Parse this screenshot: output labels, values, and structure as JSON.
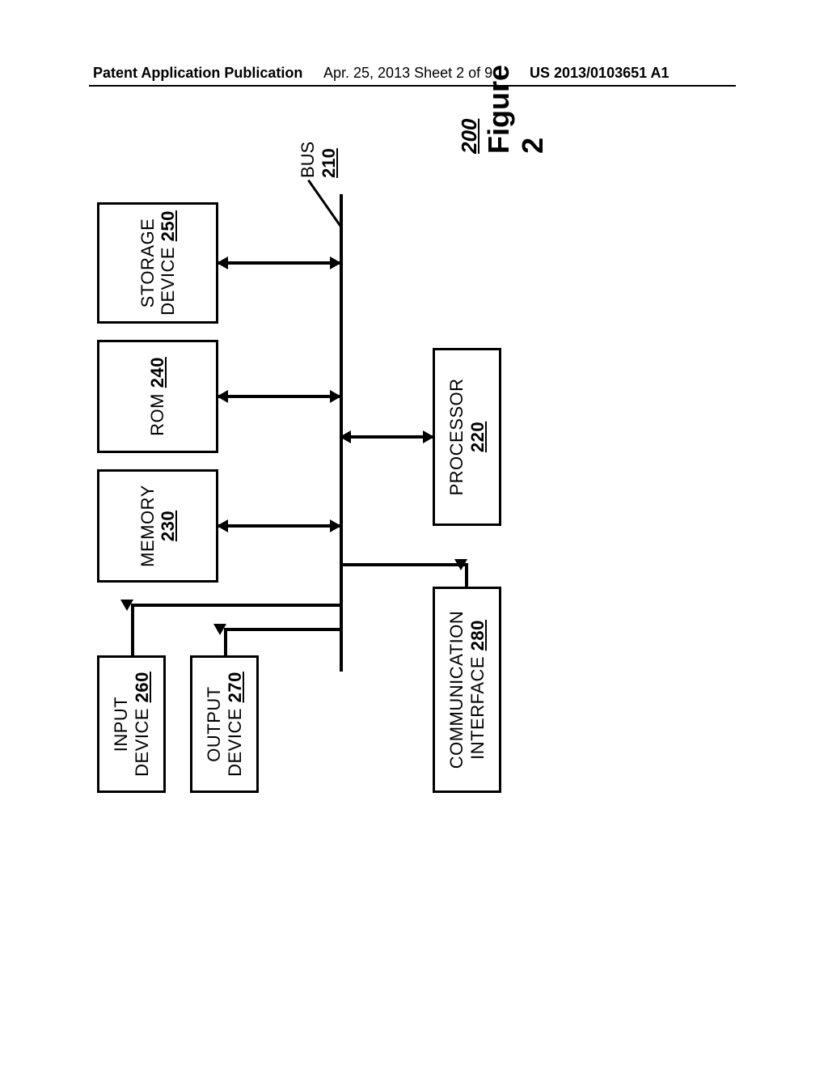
{
  "header": {
    "left": "Patent Application Publication",
    "mid": "Apr. 25, 2013  Sheet 2 of 9",
    "right": "US 2013/0103651 A1"
  },
  "boxes": {
    "input": {
      "line1": "INPUT",
      "line2": "DEVICE",
      "ref": "260"
    },
    "output": {
      "line1": "OUTPUT",
      "line2": "DEVICE",
      "ref": "270"
    },
    "comm": {
      "line1": "COMMUNICATION",
      "line2": "INTERFACE",
      "ref": "280"
    },
    "memory": {
      "line1": "MEMORY",
      "ref": "230"
    },
    "rom": {
      "line1": "ROM",
      "ref": "240"
    },
    "storage": {
      "line1": "STORAGE",
      "line2": "DEVICE",
      "ref": "250"
    },
    "processor": {
      "line1": "PROCESSOR",
      "ref": "220"
    }
  },
  "bus": {
    "label": "BUS",
    "ref": "210"
  },
  "figure": {
    "num": "200",
    "label": "Figure 2"
  }
}
